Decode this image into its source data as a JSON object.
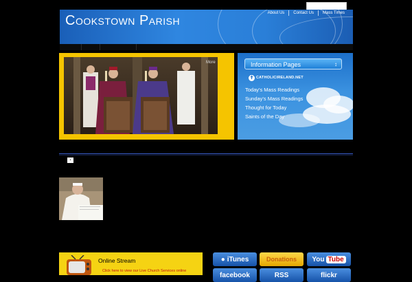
{
  "site": {
    "title": "Cookstown Parish"
  },
  "search": {
    "placeholder": ""
  },
  "top_nav": [
    "About Us",
    "Contact Us",
    "Mass Times"
  ],
  "video": {
    "more_label": "More"
  },
  "info_panel": {
    "select_label": "Information Pages",
    "logo_text": "CATHOLICIRELAND.NET",
    "links": [
      "Today's Mass Readings",
      "Sunday's Mass Readings",
      "Thought for Today",
      "Saints of the Day"
    ]
  },
  "stream": {
    "title": "Online Stream",
    "link": "Click here to view our Live Church Services online"
  },
  "social": {
    "itunes": "iTunes",
    "donations": "Donations",
    "youtube_you": "You",
    "youtube_tube": "Tube",
    "facebook": "facebook",
    "rss": "RSS",
    "flickr": "flickr"
  },
  "colors": {
    "accent_yellow": "#f5c400",
    "brand_blue": "#2f86e0",
    "background": "#000000"
  }
}
